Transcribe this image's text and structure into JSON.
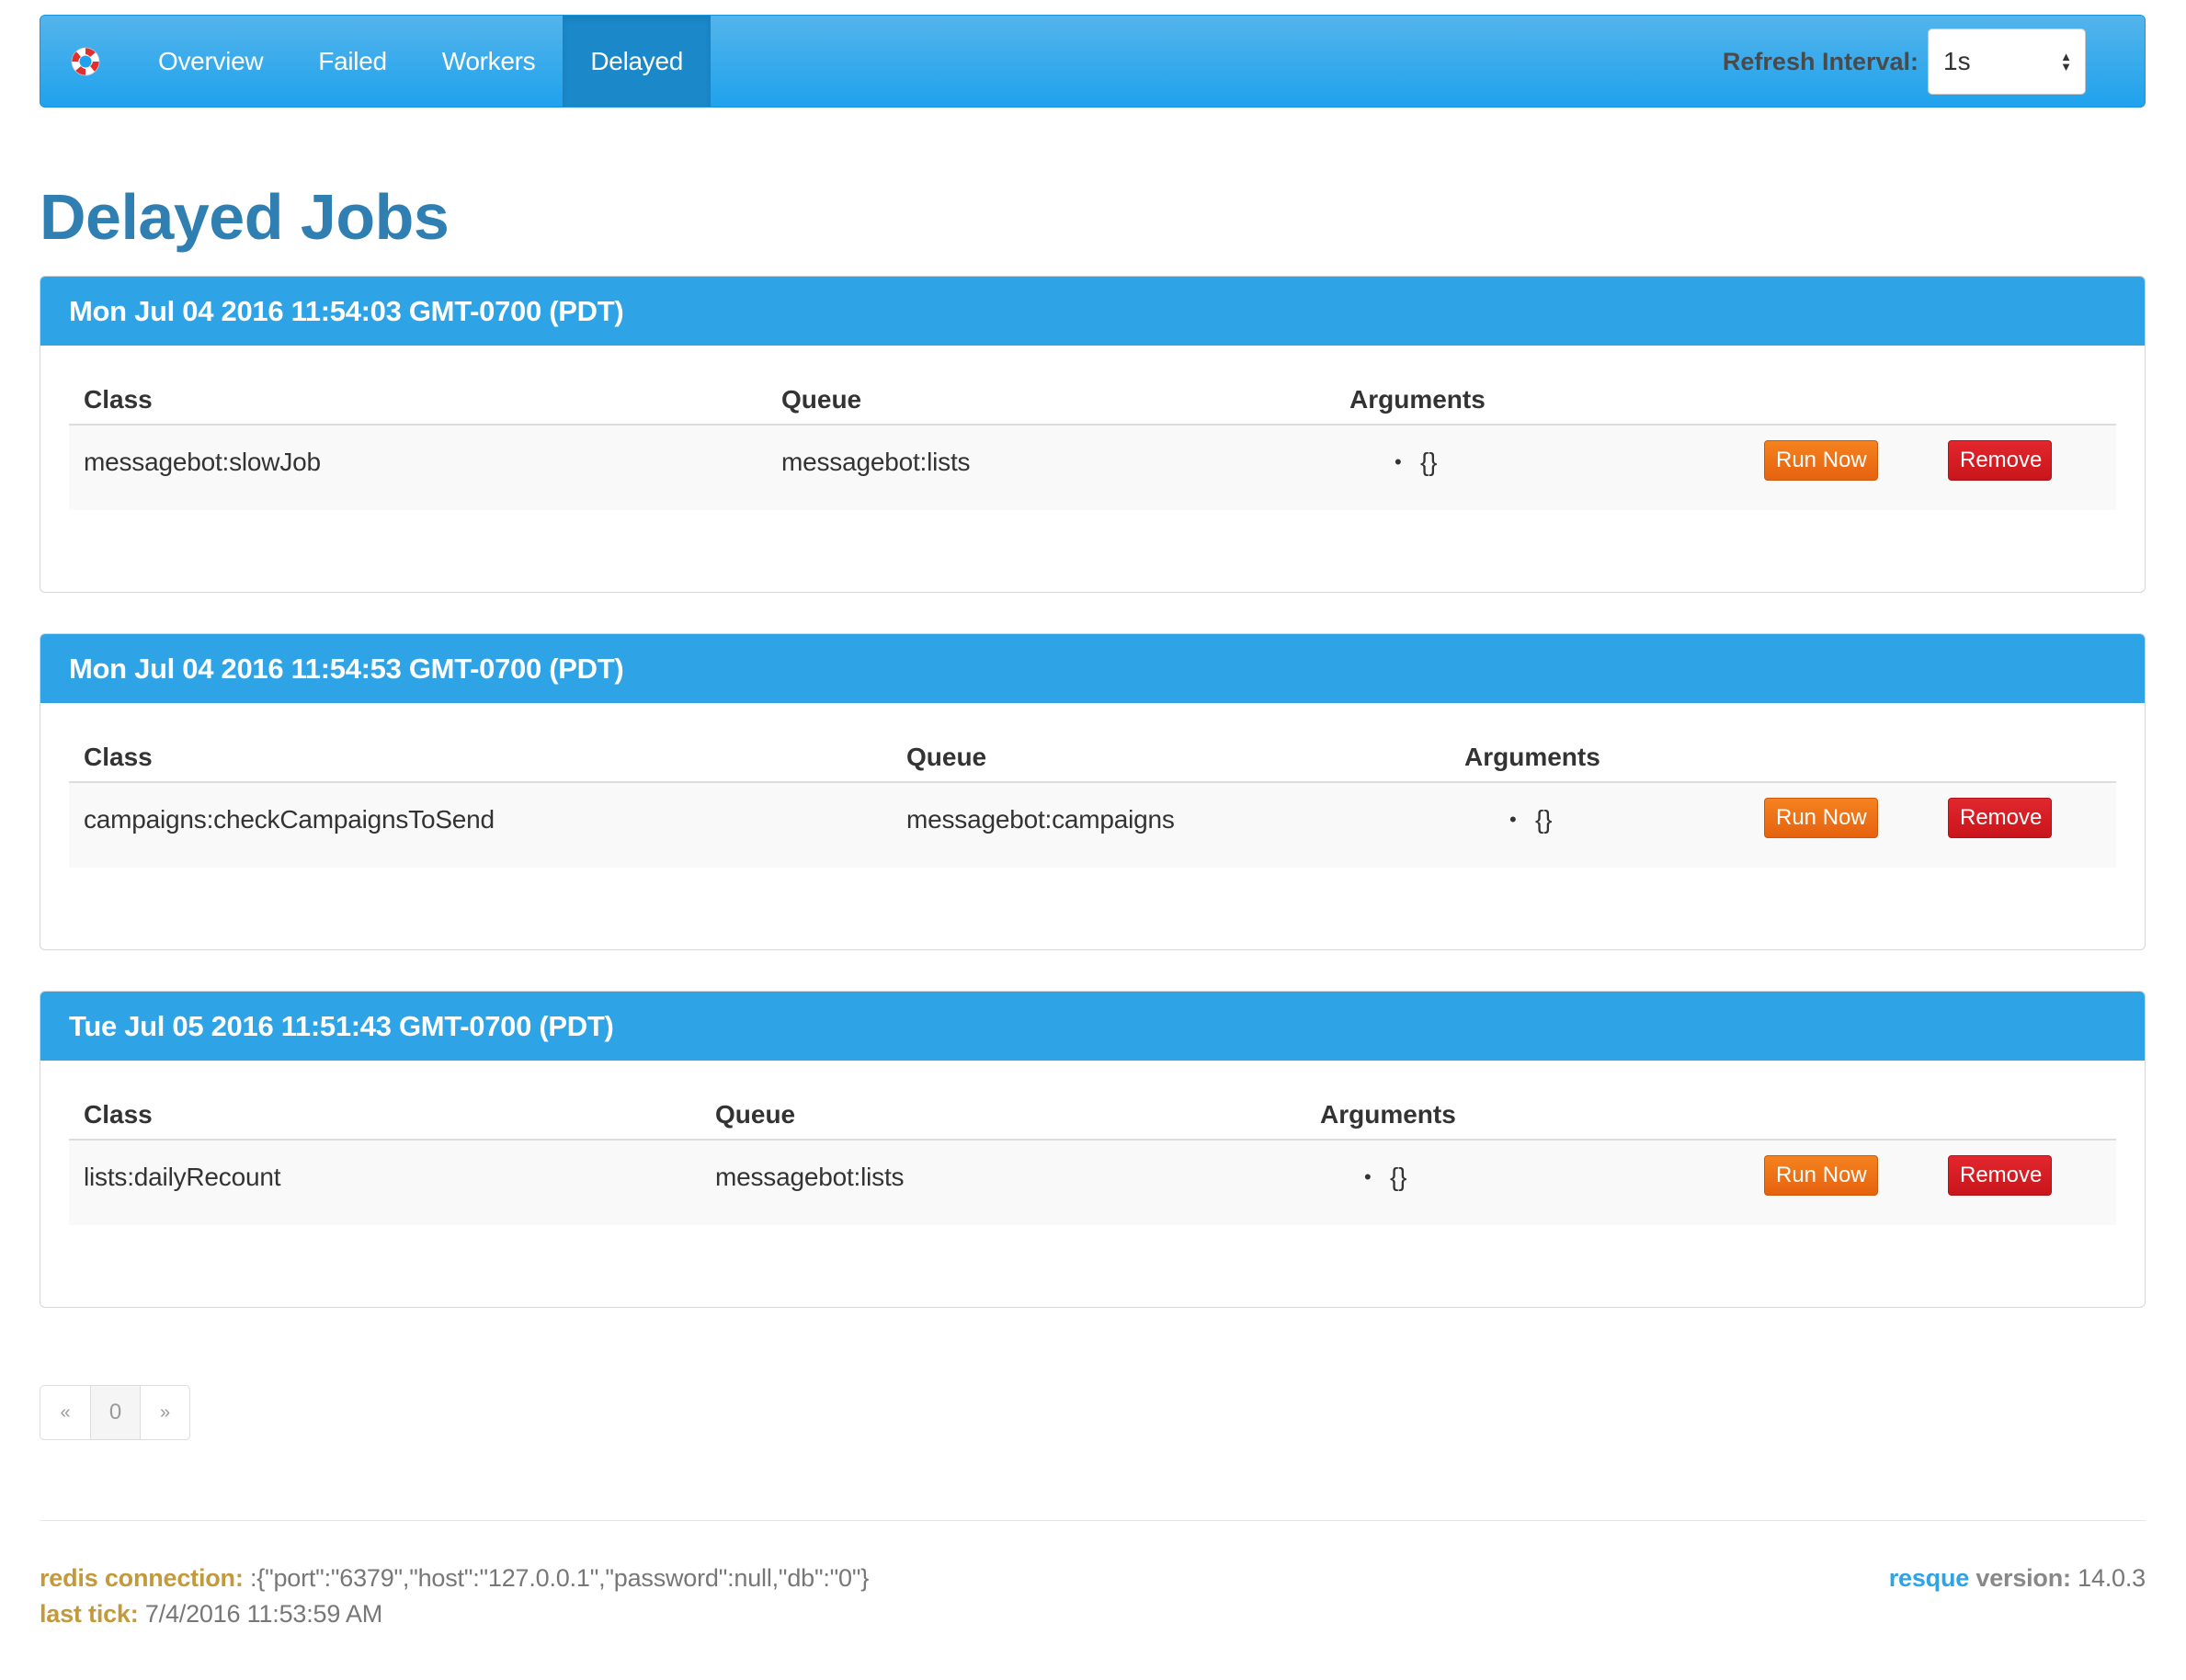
{
  "nav": {
    "items": [
      {
        "label": "Overview"
      },
      {
        "label": "Failed"
      },
      {
        "label": "Workers"
      },
      {
        "label": "Delayed",
        "active": true
      }
    ],
    "refresh_label": "Refresh Interval:",
    "refresh_value": "1s",
    "brand_icon": "lifebuoy-icon"
  },
  "page": {
    "title": "Delayed Jobs"
  },
  "table_headers": {
    "class": "Class",
    "queue": "Queue",
    "arguments": "Arguments"
  },
  "buttons": {
    "run_now": "Run Now",
    "remove": "Remove"
  },
  "delayed": [
    {
      "timestamp": "Mon Jul 04 2016 11:54:03 GMT-0700 (PDT)",
      "jobs": [
        {
          "class": "messagebot:slowJob",
          "queue": "messagebot:lists",
          "args": [
            "{}"
          ]
        }
      ]
    },
    {
      "timestamp": "Mon Jul 04 2016 11:54:53 GMT-0700 (PDT)",
      "jobs": [
        {
          "class": "campaigns:checkCampaignsToSend",
          "queue": "messagebot:campaigns",
          "args": [
            "{}"
          ]
        }
      ]
    },
    {
      "timestamp": "Tue Jul 05 2016 11:51:43 GMT-0700 (PDT)",
      "jobs": [
        {
          "class": "lists:dailyRecount",
          "queue": "messagebot:lists",
          "args": [
            "{}"
          ]
        }
      ]
    }
  ],
  "pagination": {
    "prev": "«",
    "current": "0",
    "next": "»"
  },
  "footer": {
    "redis_label": "redis connection:",
    "redis_value": ":{\"port\":\"6379\",\"host\":\"127.0.0.1\",\"password\":null,\"db\":\"0\"}",
    "tick_label": "last tick:",
    "tick_value": "7/4/2016 11:53:59 AM",
    "brand": "resque",
    "version_label": "version:",
    "version_value": "14.0.3"
  },
  "colors": {
    "navbar": "#1fa2ed",
    "panel_heading": "#2ea3e6",
    "title": "#2f7fb2",
    "run_now": "#e6620f",
    "remove": "#c8151b",
    "footer_key": "#c39a3b"
  }
}
